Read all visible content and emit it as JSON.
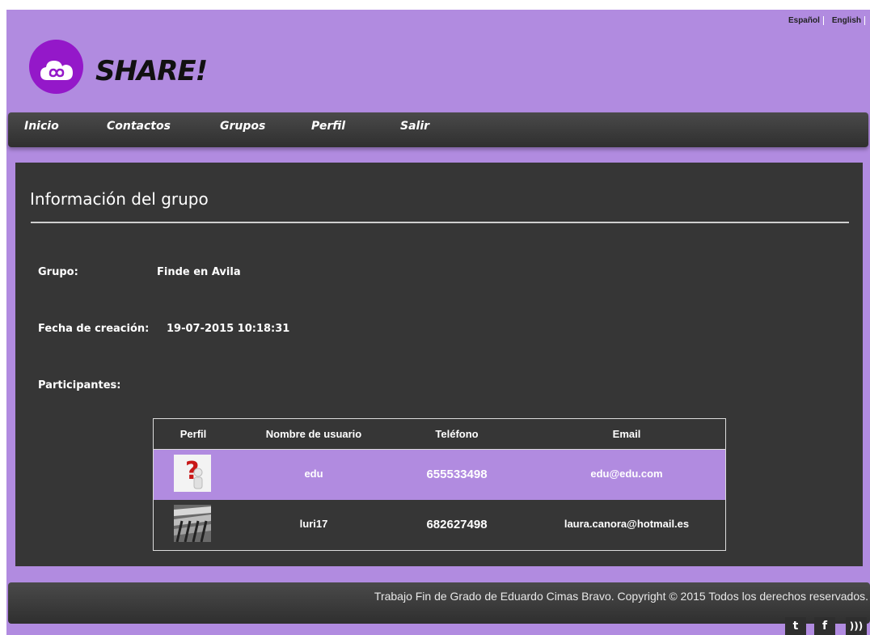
{
  "languages": [
    "Español",
    "English"
  ],
  "brand": {
    "name": "SHARE!",
    "logo_icon": "cloud-infinity-icon",
    "logo_color": "#9418c9"
  },
  "nav": {
    "items": [
      "Inicio",
      "Contactos",
      "Grupos",
      "Perfil",
      "Salir"
    ]
  },
  "colors": {
    "accent": "#b18be0",
    "panel": "#363636",
    "bar": "#3a3a3a"
  },
  "group_info": {
    "title": "Información del grupo",
    "group_label": "Grupo:",
    "group_value": "Finde en Avila",
    "date_label": "Fecha de creación:",
    "date_value": "19-07-2015 10:18:31",
    "participants_label": "Participantes:"
  },
  "table": {
    "headers": [
      "Perfil",
      "Nombre de usuario",
      "Teléfono",
      "Email"
    ],
    "rows": [
      {
        "avatar": "question-mark-avatar",
        "username": "edu",
        "phone": "655533498",
        "email": "edu@edu.com"
      },
      {
        "avatar": "photo-avatar",
        "username": "luri17",
        "phone": "682627498",
        "email": "laura.canora@hotmail.es"
      }
    ]
  },
  "footer": {
    "text": "Trabajo Fin de Grado de Eduardo Cimas Bravo. Copyright © 2015 Todos los derechos reservados.",
    "social": [
      "twitter-icon",
      "facebook-icon",
      "rss-icon"
    ]
  }
}
